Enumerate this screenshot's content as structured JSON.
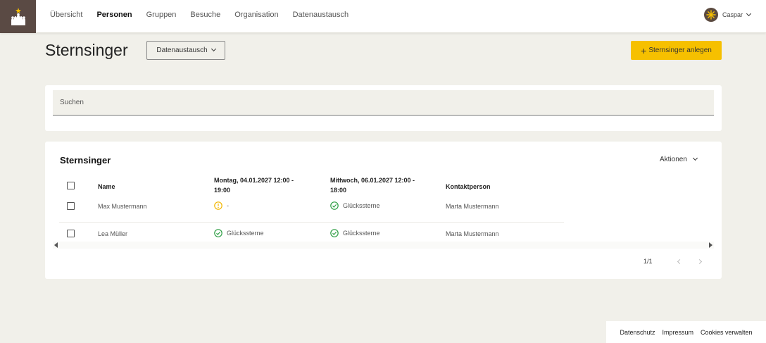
{
  "nav": {
    "items": [
      {
        "label": "Übersicht",
        "active": false
      },
      {
        "label": "Personen",
        "active": true
      },
      {
        "label": "Gruppen",
        "active": false
      },
      {
        "label": "Besuche",
        "active": false
      },
      {
        "label": "Organisation",
        "active": false
      },
      {
        "label": "Datenaustausch",
        "active": false
      }
    ],
    "user_name": "Caspar"
  },
  "page": {
    "title": "Sternsinger",
    "dropdown_label": "Datenaustausch",
    "add_button_label": "Sternsinger anlegen"
  },
  "search": {
    "placeholder": "Suchen"
  },
  "list": {
    "title": "Sternsinger",
    "actions_label": "Aktionen",
    "columns": {
      "name": "Name",
      "day1": "Montag, 04.01.2027 12:00 - 19:00",
      "day2": "Mittwoch, 06.01.2027 12:00 - 18:00",
      "contact": "Kontaktperson"
    },
    "rows": [
      {
        "name": "Max Mustermann",
        "day1": "-",
        "day1_status": "warning-icon",
        "day2": "Glückssterne",
        "day2_status": "check-circle-icon",
        "contact": "Marta Mustermann"
      },
      {
        "name": "Lea Müller",
        "day1": "Glückssterne",
        "day1_status": "check-circle-icon",
        "day2": "Glückssterne",
        "day2_status": "check-circle-icon",
        "contact": "Marta Mustermann"
      }
    ],
    "pagination": "1/1"
  },
  "footer": {
    "links": [
      "Datenschutz",
      "Impressum",
      "Cookies verwalten"
    ]
  },
  "colors": {
    "accent": "#f6c000",
    "logo_bg": "#5a4a44",
    "success": "#2e9e44",
    "warning": "#f2b600",
    "page_bg": "#f1f0ea"
  }
}
